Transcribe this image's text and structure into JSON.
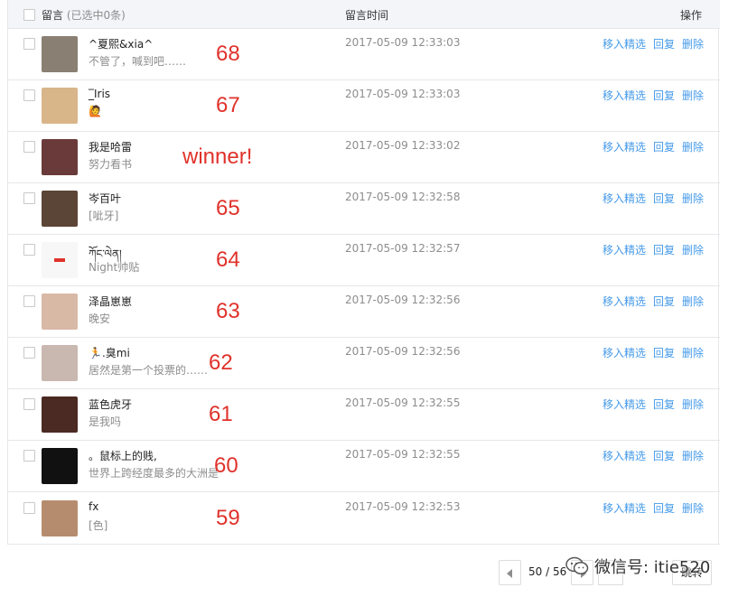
{
  "header": {
    "message_label": "留言",
    "selected_note": "(已选中0条)",
    "time_label": "留言时间",
    "action_label": "操作"
  },
  "rows": [
    {
      "nick": "^夏熙&xia^",
      "content": "不管了，喊到吧……",
      "time": "2017-05-09 12:33:03",
      "mark": "68",
      "avatar_color": "#8a7f73"
    },
    {
      "nick": "_̲̅Iris",
      "content": "🙋",
      "time": "2017-05-09 12:33:03",
      "mark": "67",
      "avatar_color": "#d9b58a"
    },
    {
      "nick": "我是哈雷",
      "content": "努力看书",
      "time": "2017-05-09 12:33:02",
      "mark": "winner!",
      "avatar_color": "#6a3a3a"
    },
    {
      "nick": "岑百叶",
      "content": "[呲牙]",
      "time": "2017-05-09 12:32:58",
      "mark": "65",
      "avatar_color": "#5b4537"
    },
    {
      "nick": "ཀོང་ལེན།",
      "content": "Night帅贴",
      "time": "2017-05-09 12:32:57",
      "mark": "64",
      "avatar_color": "#f7f7f7"
    },
    {
      "nick": "泽晶崽崽",
      "content": "晚安",
      "time": "2017-05-09 12:32:56",
      "mark": "63",
      "avatar_color": "#d8b9a6"
    },
    {
      "nick": "🏃.臭mi",
      "content": "居然是第一个投票的……",
      "time": "2017-05-09 12:32:56",
      "mark": "62",
      "avatar_color": "#c9b8b0"
    },
    {
      "nick": "蓝色虎牙",
      "content": "是我吗",
      "time": "2017-05-09 12:32:55",
      "mark": "61",
      "avatar_color": "#4a2a22"
    },
    {
      "nick": "。鼠标上的贱,",
      "content": "世界上跨经度最多的大洲是",
      "time": "2017-05-09 12:32:55",
      "mark": "60",
      "avatar_color": "#111111"
    },
    {
      "nick": "fx",
      "content": "[色]",
      "time": "2017-05-09 12:32:53",
      "mark": "59",
      "avatar_color": "#b58d6e"
    }
  ],
  "actions": {
    "feature": "移入精选",
    "reply": "回复",
    "delete": "删除"
  },
  "pager": {
    "page_text": "50 / 56",
    "go_label": "跳转"
  },
  "watermark": {
    "text": "微信号: itie520"
  },
  "colors": {
    "link": "#459ae9",
    "annotation": "#e0322b"
  }
}
